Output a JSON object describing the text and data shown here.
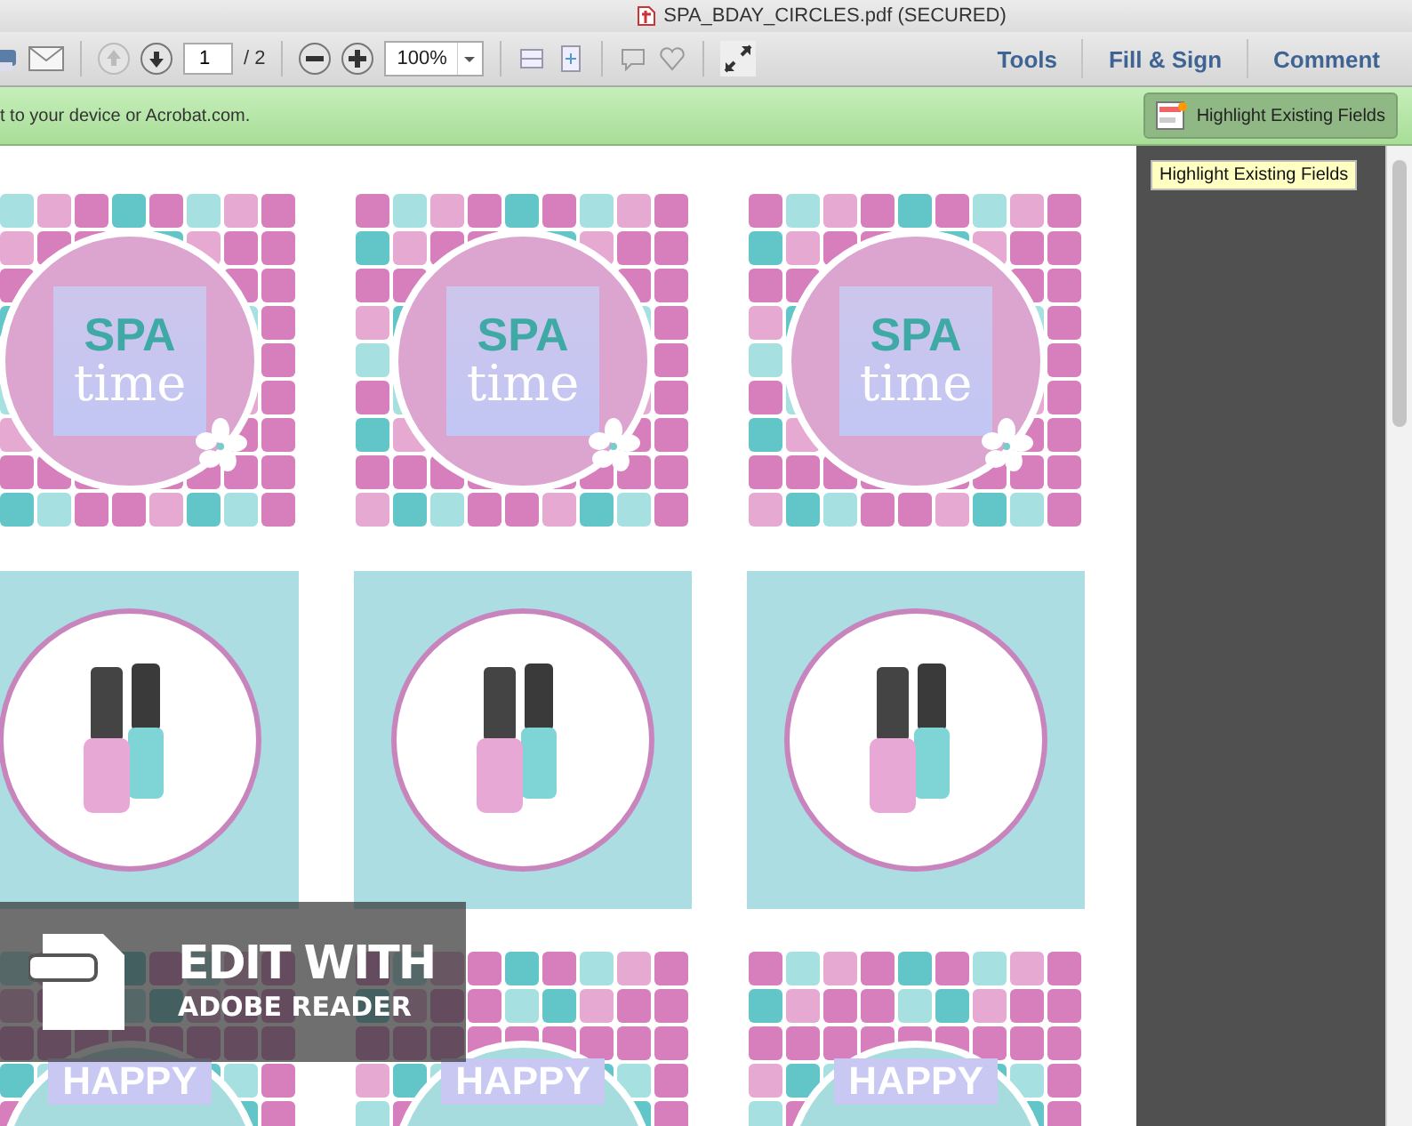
{
  "window": {
    "title": "SPA_BDAY_CIRCLES.pdf (SECURED)"
  },
  "toolbar": {
    "page_input": "1",
    "page_total": "/ 2",
    "zoom": "100%",
    "links": [
      "Tools",
      "Fill & Sign",
      "Comment"
    ]
  },
  "notice": {
    "text": "t to your device or Acrobat.com.",
    "button": "Highlight Existing Fields",
    "tooltip": "Highlight Existing Fields"
  },
  "document": {
    "tiles": [
      {
        "kind": "spa",
        "title": "SPA",
        "subtitle": "time"
      },
      {
        "kind": "spa",
        "title": "SPA",
        "subtitle": "time"
      },
      {
        "kind": "spa",
        "title": "SPA",
        "subtitle": "time"
      },
      {
        "kind": "polish"
      },
      {
        "kind": "polish"
      },
      {
        "kind": "polish"
      },
      {
        "kind": "birthday",
        "title": "HAPPY"
      },
      {
        "kind": "birthday",
        "title": "HAPPY"
      },
      {
        "kind": "birthday",
        "title": "HAPPY"
      }
    ]
  },
  "badge": {
    "line1": "EDIT WITH",
    "line2": "ADOBE READER"
  }
}
